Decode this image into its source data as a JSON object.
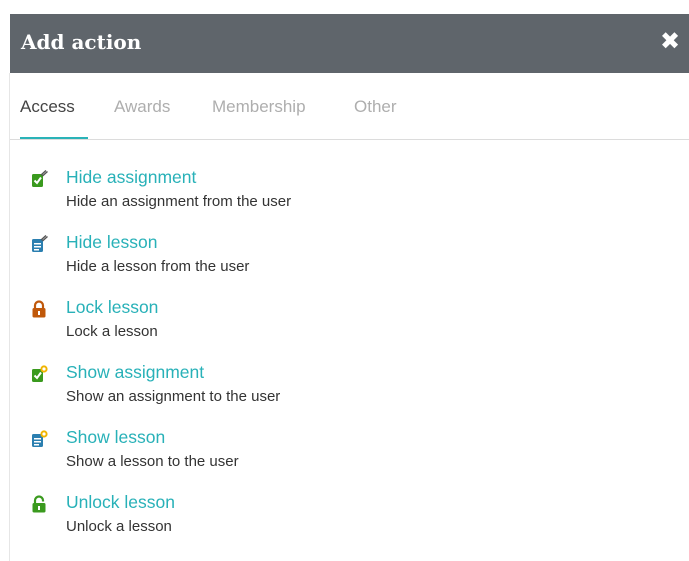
{
  "dialog": {
    "title": "Add action",
    "close_symbol": "✖"
  },
  "tabs": [
    {
      "label": "Access",
      "active": true
    },
    {
      "label": "Awards",
      "active": false
    },
    {
      "label": "Membership",
      "active": false
    },
    {
      "label": "Other",
      "active": false
    }
  ],
  "actions": [
    {
      "label": "Hide assignment",
      "description": "Hide an assignment from the user",
      "icon": "hide-assignment-icon"
    },
    {
      "label": "Hide lesson",
      "description": "Hide a lesson from the user",
      "icon": "hide-lesson-icon"
    },
    {
      "label": "Lock lesson",
      "description": "Lock a lesson",
      "icon": "lock-icon"
    },
    {
      "label": "Show assignment",
      "description": "Show an assignment to the user",
      "icon": "show-assignment-icon"
    },
    {
      "label": "Show lesson",
      "description": "Show a lesson to the user",
      "icon": "show-lesson-icon"
    },
    {
      "label": "Unlock lesson",
      "description": "Unlock a lesson",
      "icon": "unlock-icon"
    }
  ],
  "colors": {
    "header_bg": "#5f656b",
    "accent": "#2ab3b8",
    "link": "#28b1b8",
    "lock": "#c0580a",
    "unlock": "#3a9a1e",
    "assignment_green": "#3a9a1e",
    "lesson_blue": "#2b7fb0"
  }
}
